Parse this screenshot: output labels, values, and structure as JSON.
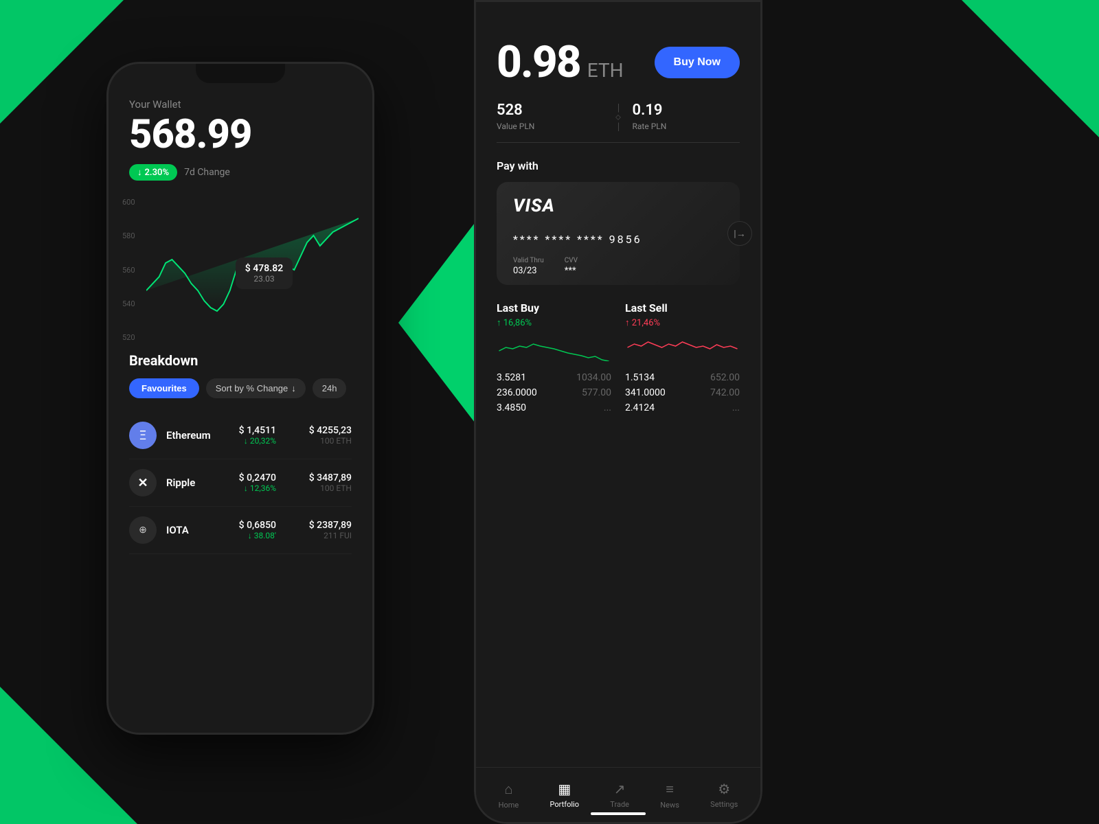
{
  "background": {
    "color": "#111111"
  },
  "phone_left": {
    "wallet_label": "Your Wallet",
    "wallet_amount": "568.99",
    "change_percent": "2.30%",
    "change_period": "7d Change",
    "chart": {
      "y_labels": [
        "600",
        "580",
        "560",
        "540",
        "520"
      ],
      "tooltip_amount": "$ 478.82",
      "tooltip_date": "23.03"
    },
    "breakdown": {
      "title": "Breakdown",
      "filter_favourites": "Favourites",
      "filter_sort": "Sort by % Change",
      "filter_time": "24h",
      "items": [
        {
          "name": "Ethereum",
          "price": "$ 1,4511",
          "change": "20,32%",
          "total": "$ 4255,23",
          "sub": "100 ETH",
          "icon": "Ξ",
          "icon_bg": "#627eea"
        },
        {
          "name": "Ripple",
          "price": "$ 0,2470",
          "change": "12,36%",
          "total": "$ 3487,89",
          "sub": "100 ETH",
          "icon": "✕",
          "icon_bg": "#2a2a2a"
        },
        {
          "name": "IOTA",
          "price": "$ 0,6850",
          "change": "38.08'",
          "total": "$ 2387,89",
          "sub": "211 FUI",
          "icon": "⊕",
          "icon_bg": "#2a2a2a"
        }
      ]
    }
  },
  "phone_right": {
    "eth_price": "0.98",
    "eth_currency": "ETH",
    "buy_now_label": "Buy Now",
    "stat1_value": "528",
    "stat1_label": "Value PLN",
    "stat2_value": "0.19",
    "stat2_label": "Rate PLN",
    "pay_with_label": "Pay with",
    "card": {
      "brand": "VISA",
      "number": "**** **** **** 9856",
      "valid_thru_label": "Valid Thru",
      "valid_thru_value": "03/23",
      "cvv_label": "CVV",
      "cvv_value": "***"
    },
    "last_buy": {
      "title": "Last Buy",
      "change": "16,86%",
      "row1_main": "3.5281",
      "row1_sub": "1034.00",
      "row2_main": "236.0000",
      "row2_sub": "577.00",
      "row3_main": "3.4850",
      "row3_sub": "..."
    },
    "last_sell": {
      "title": "Last Sell",
      "change": "21,46%",
      "row1_main": "1.5134",
      "row1_sub": "652.00",
      "row2_main": "341.0000",
      "row2_sub": "742.00",
      "row3_main": "2.4124",
      "row3_sub": "..."
    },
    "nav": {
      "home": "Home",
      "portfolio": "Portfolio",
      "trade": "Trade",
      "news": "News",
      "settings": "Settings"
    }
  }
}
